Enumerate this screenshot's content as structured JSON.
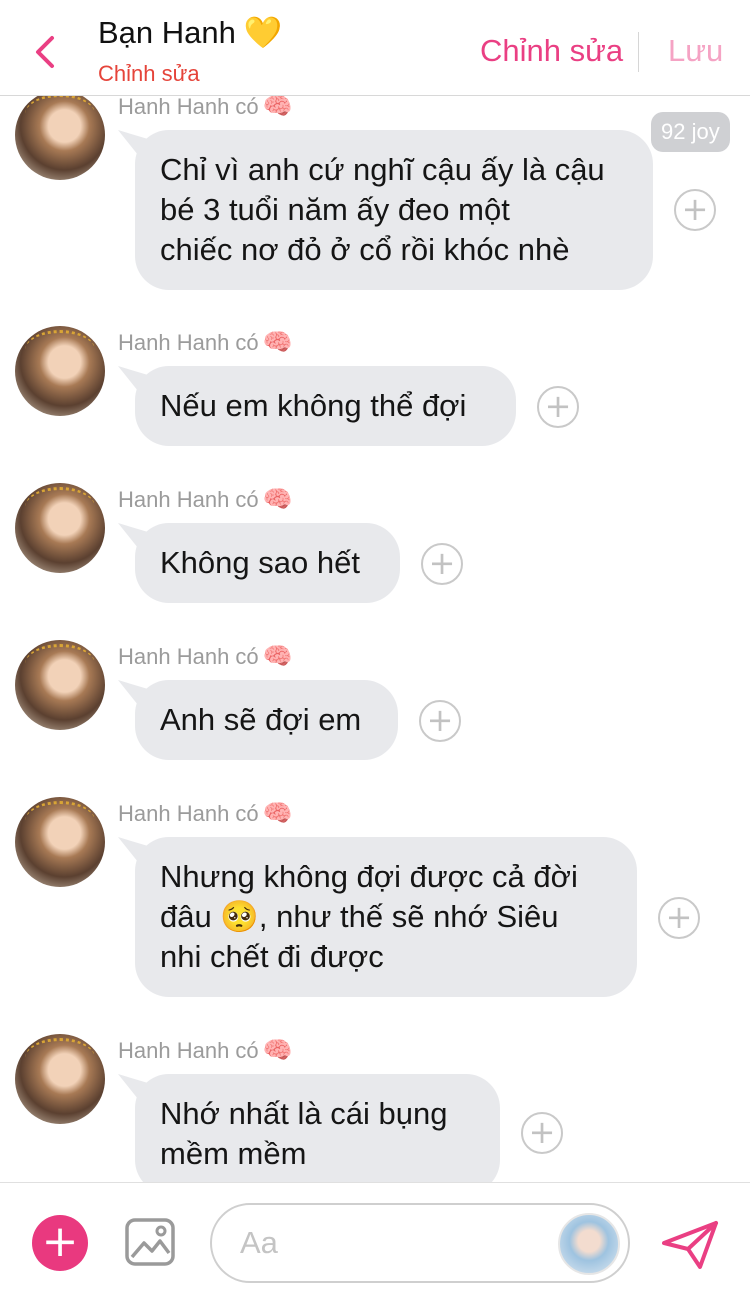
{
  "header": {
    "title": "Bạn Hanh",
    "title_emoji": "💛",
    "subtitle": "Chỉnh sửa",
    "edit_label": "Chỉnh sửa",
    "save_label": "Lưu"
  },
  "colors": {
    "accent": "#ea3f83",
    "bubble": "#e8e9ec",
    "subtitle": "#e5443a"
  },
  "messages": [
    {
      "sender": "Hanh Hanh có",
      "sender_emoji": "🧠",
      "badge": "92 joy",
      "lines": [
        "Chỉ vì anh cứ nghĩ cậu ấy là cậu",
        "bé 3 tuổi năm ấy đeo một",
        "chiếc nơ đỏ ở cổ rồi khóc nhè"
      ]
    },
    {
      "sender": "Hanh Hanh có",
      "sender_emoji": "🧠",
      "lines": [
        "Nếu em không thể đợi"
      ]
    },
    {
      "sender": "Hanh Hanh có",
      "sender_emoji": "🧠",
      "lines": [
        "Không sao hết"
      ]
    },
    {
      "sender": "Hanh Hanh có",
      "sender_emoji": "🧠",
      "lines": [
        "Anh sẽ đợi em"
      ]
    },
    {
      "sender": "Hanh Hanh có",
      "sender_emoji": "🧠",
      "lines": [
        "Nhưng không đợi được cả đời",
        "đâu 🥺, như thế sẽ nhớ Siêu",
        "nhi chết đi được"
      ]
    },
    {
      "sender": "Hanh Hanh có",
      "sender_emoji": "🧠",
      "lines": [
        "Nhớ nhất là cái bụng",
        "mềm mềm"
      ]
    }
  ],
  "add_symbol": "+",
  "composer": {
    "placeholder": "Aa",
    "plus_symbol": "+"
  }
}
